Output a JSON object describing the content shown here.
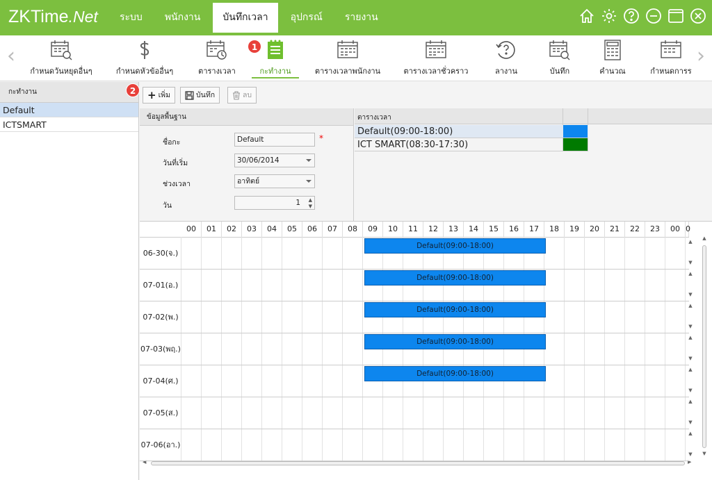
{
  "app": {
    "logo_main": "ZKTime",
    "logo_net": ".Net"
  },
  "menu": [
    {
      "label": "ระบบ"
    },
    {
      "label": "พนักงาน"
    },
    {
      "label": "บันทึกเวลา",
      "active": true
    },
    {
      "label": "อุปกรณ์"
    },
    {
      "label": "รายงาน"
    }
  ],
  "toolbar": {
    "items": [
      {
        "label": "กำหนดวันหยุดอื่นๆ",
        "icon": "calendar-search-icon"
      },
      {
        "label": "กำหนดหัวข้ออื่นๆ",
        "icon": "dollar-icon"
      },
      {
        "label": "ตารางเวลา",
        "icon": "calendar-clock-icon"
      },
      {
        "label": "กะทำงาน",
        "icon": "list-icon",
        "active": true
      },
      {
        "label": "ตารางเวลาพนักงาน",
        "icon": "calendar-icon"
      },
      {
        "label": "ตารางเวลาชั่วคราว",
        "icon": "calendar-icon"
      },
      {
        "label": "ลางาน",
        "icon": "question-refresh-icon"
      },
      {
        "label": "บันทึก",
        "icon": "calendar-search-icon"
      },
      {
        "label": "คำนวณ",
        "icon": "calculator-icon"
      },
      {
        "label": "กำหนดการร",
        "icon": "calendar-icon"
      }
    ],
    "badge1": "1",
    "badge2": "2"
  },
  "left_panel": {
    "header": "กะทำงาน",
    "items": [
      {
        "label": "Default",
        "selected": true
      },
      {
        "label": "ICTSMART"
      }
    ]
  },
  "actions": {
    "add": "เพิ่ม",
    "save": "บันทึก",
    "delete": "ลบ"
  },
  "basic_info": {
    "header": "ข้อมูลพื้นฐาน",
    "name_label": "ชื่อกะ",
    "name_value": "Default",
    "start_label": "วันที่เริ่ม",
    "start_value": "30/06/2014",
    "period_label": "ช่วงเวลา",
    "period_value": "อาทิตย์",
    "days_label": "วัน",
    "days_value": "1",
    "required_mark": "*"
  },
  "schedule_list": {
    "header": "ตารางเวลา",
    "rows": [
      {
        "label": "Default(09:00-18:00)",
        "color": "#0d86ee",
        "selected": true
      },
      {
        "label": "ICT SMART(08:30-17:30)",
        "color": "#007a00"
      }
    ]
  },
  "grid": {
    "hours": [
      "00",
      "01",
      "02",
      "03",
      "04",
      "05",
      "06",
      "07",
      "08",
      "09",
      "10",
      "11",
      "12",
      "13",
      "14",
      "15",
      "16",
      "17",
      "18",
      "19",
      "20",
      "21",
      "22",
      "23",
      "00",
      "0"
    ],
    "rows": [
      {
        "label": "06-30(จ.)",
        "shift": "Default(09:00-18:00)"
      },
      {
        "label": "07-01(อ.)",
        "shift": "Default(09:00-18:00)"
      },
      {
        "label": "07-02(พ.)",
        "shift": "Default(09:00-18:00)"
      },
      {
        "label": "07-03(พฤ.)",
        "shift": "Default(09:00-18:00)"
      },
      {
        "label": "07-04(ศ.)",
        "shift": "Default(09:00-18:00)"
      },
      {
        "label": "07-05(ส.)",
        "shift": ""
      },
      {
        "label": "07-06(อา.)",
        "shift": ""
      }
    ],
    "shift_color": "#0d86ee"
  }
}
